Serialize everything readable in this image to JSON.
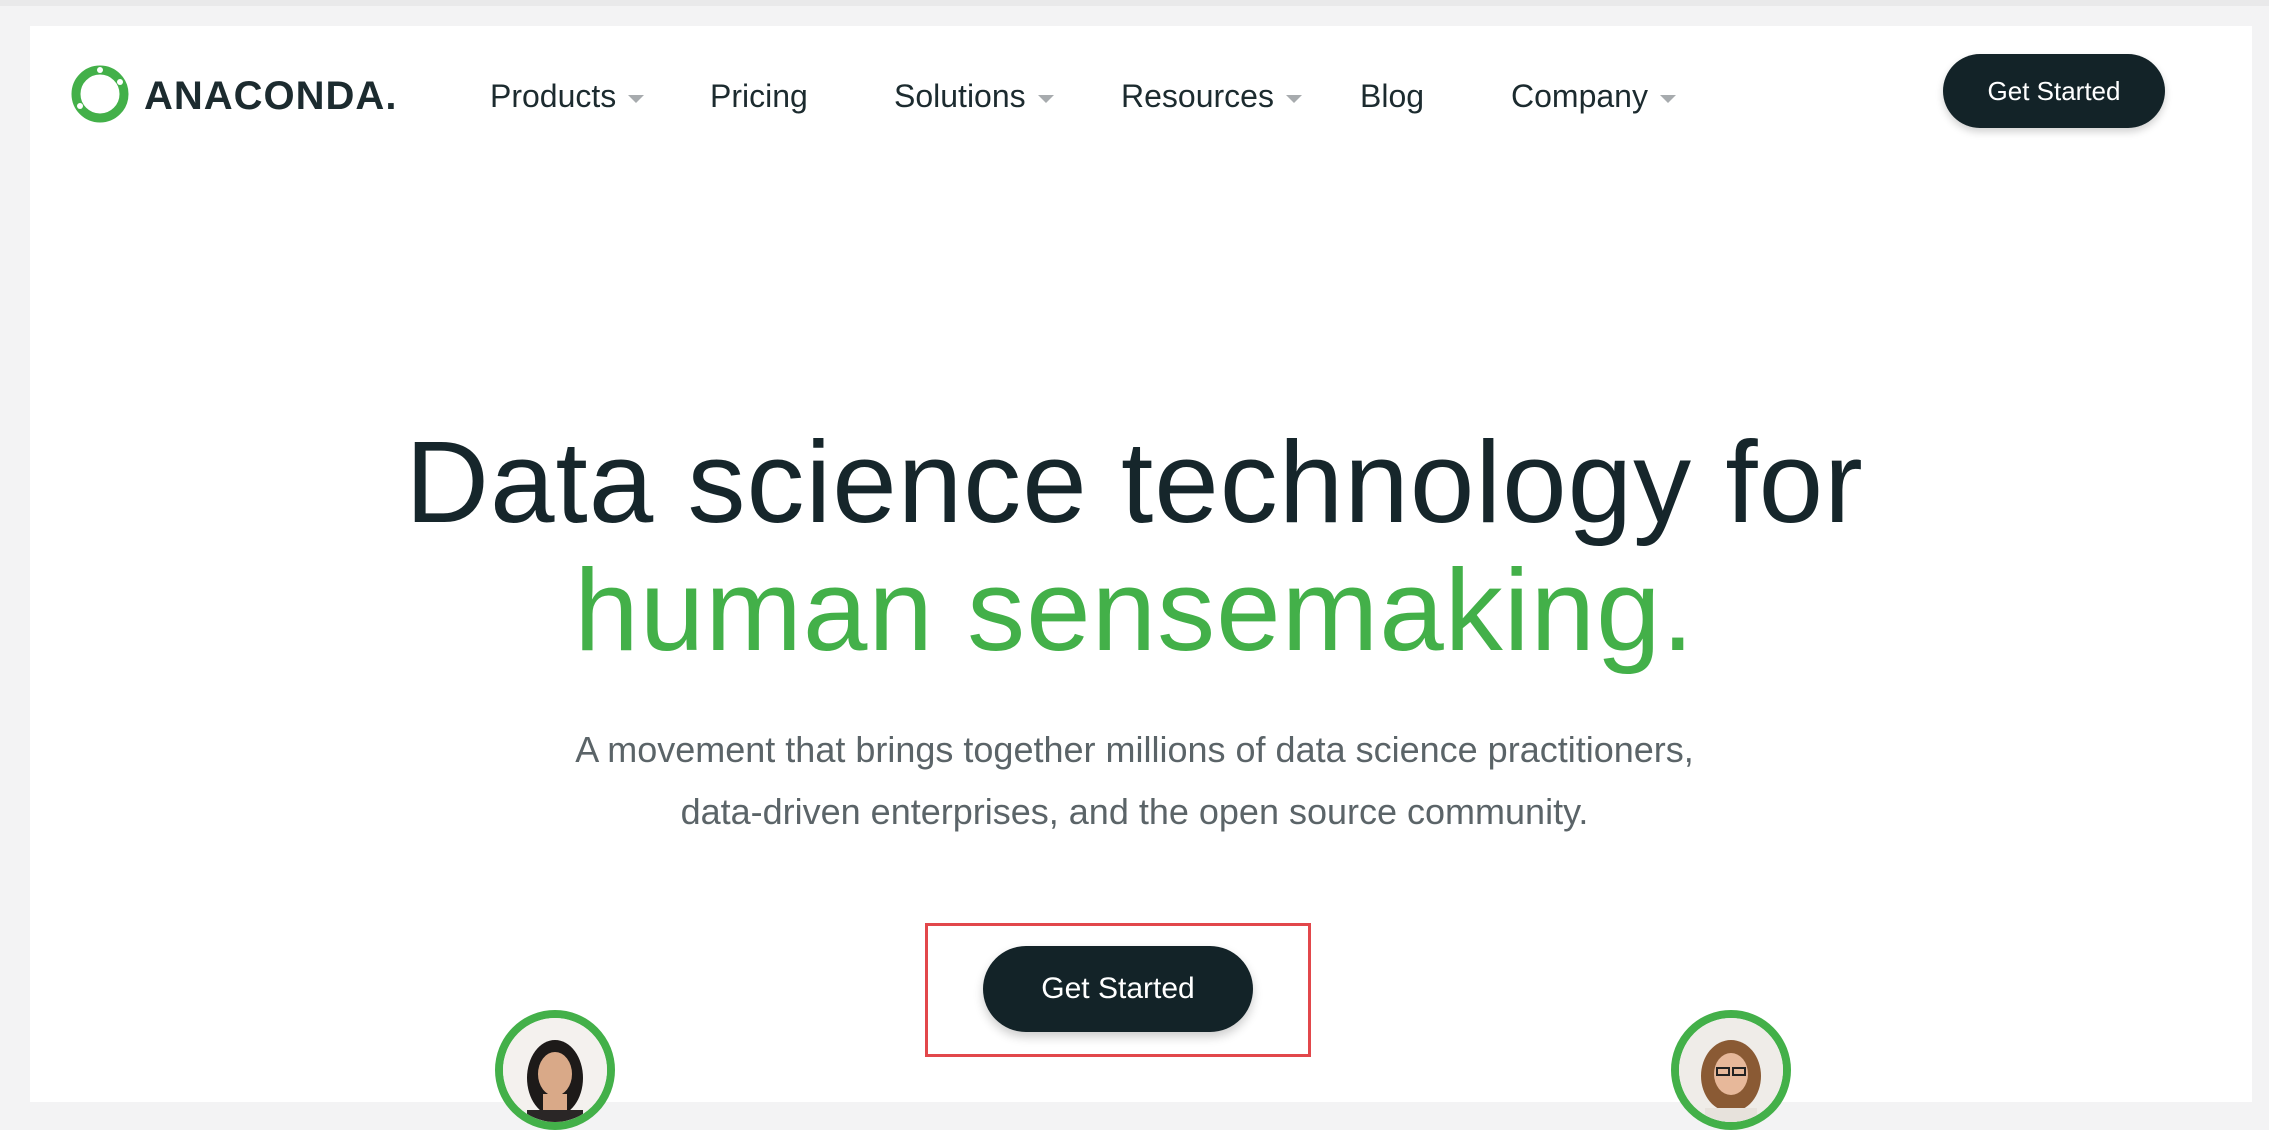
{
  "brand": {
    "name": "ANACONDA.",
    "accent": "#43b049",
    "dark": "#132328",
    "highlight": "#e2474b"
  },
  "nav": {
    "items": [
      {
        "label": "Products",
        "dropdown": true
      },
      {
        "label": "Pricing",
        "dropdown": false
      },
      {
        "label": "Solutions",
        "dropdown": true
      },
      {
        "label": "Resources",
        "dropdown": true
      },
      {
        "label": "Blog",
        "dropdown": false
      },
      {
        "label": "Company",
        "dropdown": true
      }
    ],
    "cta_label": "Get Started"
  },
  "hero": {
    "title_line1": "Data science technology for",
    "title_line2": "human sensemaking.",
    "subtitle_line1": "A movement that brings together millions of data science practitioners,",
    "subtitle_line2": "data-driven enterprises, and the open source community.",
    "cta_label": "Get Started"
  },
  "icons": {
    "logo": "anaconda-ring-icon",
    "dropdown": "chevron-down-icon"
  }
}
